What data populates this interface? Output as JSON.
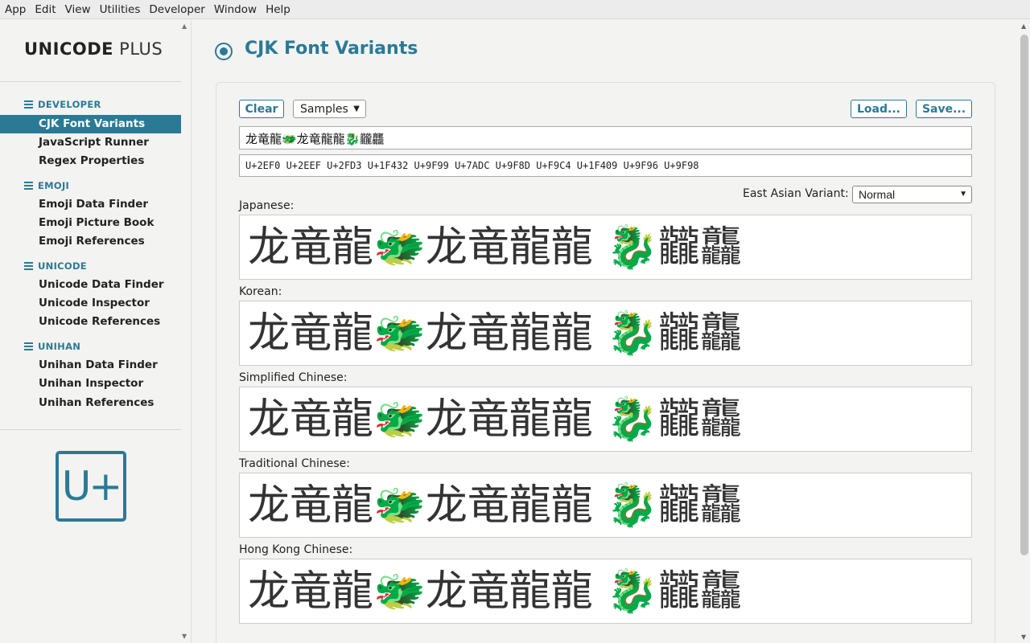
{
  "menu": [
    "App",
    "Edit",
    "View",
    "Utilities",
    "Developer",
    "Window",
    "Help"
  ],
  "brand": {
    "strong": "UNICODE",
    "light": "PLUS"
  },
  "sidebar": {
    "sections": [
      {
        "title": "DEVELOPER",
        "items": [
          "CJK Font Variants",
          "JavaScript Runner",
          "Regex Properties"
        ]
      },
      {
        "title": "EMOJI",
        "items": [
          "Emoji Data Finder",
          "Emoji Picture Book",
          "Emoji References"
        ]
      },
      {
        "title": "UNICODE",
        "items": [
          "Unicode Data Finder",
          "Unicode Inspector",
          "Unicode References"
        ]
      },
      {
        "title": "UNIHAN",
        "items": [
          "Unihan Data Finder",
          "Unihan Inspector",
          "Unihan References"
        ]
      }
    ],
    "active_item": "CJK Font Variants",
    "logo_text": "U+"
  },
  "page": {
    "title": "CJK Font Variants"
  },
  "toolbar": {
    "clear": "Clear",
    "samples": "Samples",
    "load": "Load...",
    "save": "Save..."
  },
  "input": {
    "text": "龙竜龍🐲龙竜龍龍🐉龖龘",
    "codepoints": "U+2EF0 U+2EEF U+2FD3 U+1F432 U+9F99 U+7ADC U+9F8D U+F9C4 U+1F409 U+9F96 U+9F98"
  },
  "variant": {
    "label": "East Asian Variant:",
    "selected": "Normal"
  },
  "samples": [
    {
      "label": "Japanese:",
      "text": "龙竜龍🐲龙竜龍龍 🐉龖龘"
    },
    {
      "label": "Korean:",
      "text": "龙竜龍🐲龙竜龍龍 🐉龖龘"
    },
    {
      "label": "Simplified Chinese:",
      "text": "龙竜龍🐲龙竜龍龍 🐉龖龘"
    },
    {
      "label": "Traditional Chinese:",
      "text": "龙竜龍🐲龙竜龍龍 🐉龖龘"
    },
    {
      "label": "Hong Kong Chinese:",
      "text": "龙竜龍🐲龙竜龍龍 🐉龖龘"
    }
  ],
  "colors": {
    "accent": "#2a7a96",
    "background": "#f3f3f1"
  }
}
